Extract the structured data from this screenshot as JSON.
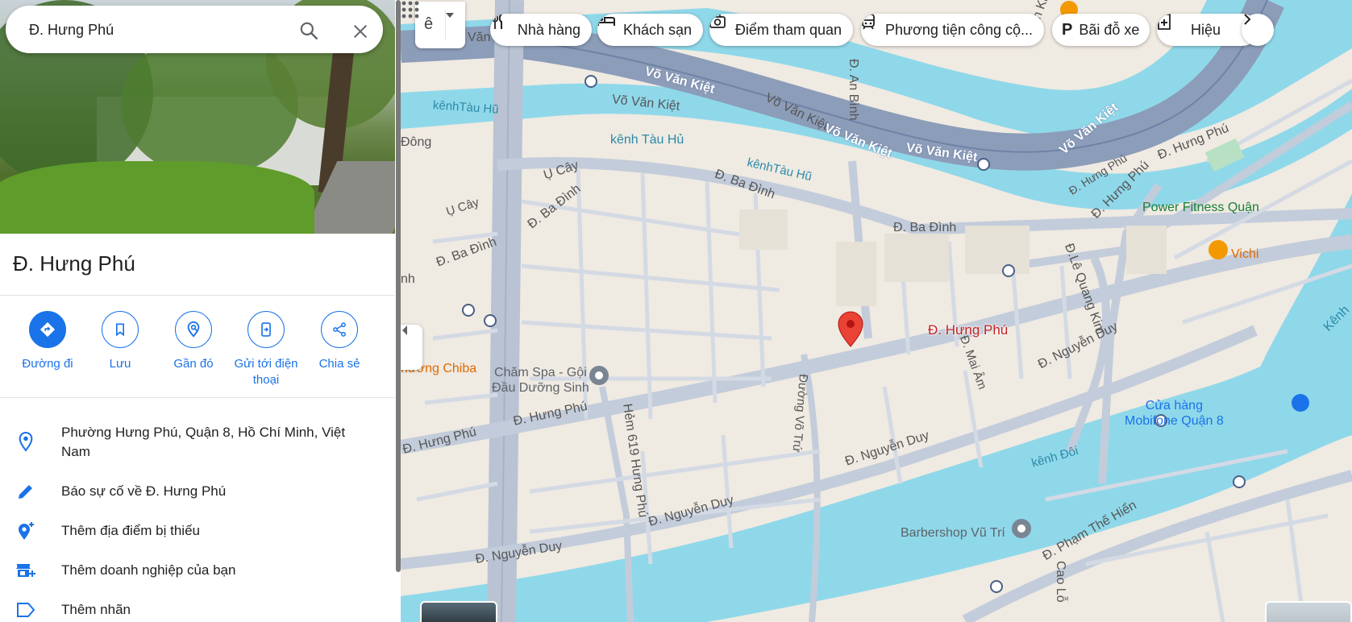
{
  "search": {
    "query": "Đ. Hưng Phú"
  },
  "place": {
    "title": "Đ. Hưng Phú"
  },
  "actions": [
    {
      "label": "Đường đi",
      "icon": "directions-icon"
    },
    {
      "label": "Lưu",
      "icon": "bookmark-icon"
    },
    {
      "label": "Gần đó",
      "icon": "nearby-icon"
    },
    {
      "label": "Gửi tới điện thoại",
      "icon": "send-to-phone-icon"
    },
    {
      "label": "Chia sẻ",
      "icon": "share-icon"
    }
  ],
  "details": [
    {
      "text": "Phường Hưng Phú, Quận 8, Hồ Chí Minh, Việt Nam",
      "icon": "location-pin-icon"
    },
    {
      "text": "Báo sự cố về Đ. Hưng Phú",
      "icon": "pencil-icon"
    },
    {
      "text": "Thêm địa điểm bị thiếu",
      "icon": "add-place-icon"
    },
    {
      "text": "Thêm doanh nghiệp của bạn",
      "icon": "add-business-icon"
    },
    {
      "text": "Thêm nhãn",
      "icon": "label-icon"
    }
  ],
  "layers": {
    "glyph": "ê"
  },
  "chips": [
    {
      "label": "Nhà hàng",
      "icon": "restaurant-icon"
    },
    {
      "label": "Khách sạn",
      "icon": "hotel-icon"
    },
    {
      "label": "Điểm tham quan",
      "icon": "camera-icon"
    },
    {
      "label": "Phương tiện công cộ...",
      "icon": "transit-icon"
    },
    {
      "label": "Bãi đỗ xe",
      "icon": "parking-icon"
    },
    {
      "label": "Hiệu",
      "icon": "pharmacy-icon"
    }
  ],
  "map": {
    "pin_label": "Đ. Hưng Phú",
    "labels": {
      "van_kiet_1": "Võ Văn Kiệt",
      "van_kiet_2": "Võ Văn Kiệt",
      "van_kiet_3": "Võ Văn Kiệt",
      "van_kiet_4": "Võ Văn Kiệt",
      "van_kiet_5": "Võ Văn Kiệt",
      "van_kiet_6": "Võ Văn Kiệt",
      "van_top": "Văn",
      "kenh_tau_hu_1": "kênhTàu Hũ",
      "kenh_tau_hu_2": "kênh Tàu Hủ",
      "kenh_tau_hu_3": "kênhTàu Hũ",
      "kenh_doi": "kênh Đôi",
      "kenh_right": "Kênh",
      "dong": "Đông",
      "u_cay_1": "Ụ Cây",
      "u_cay_2": "Ụ Cây",
      "ba_dinh_1": "Đ. Ba Đình",
      "ba_dinh_2": "Đ. Ba Đình",
      "ba_dinh_3": "Đ. Ba Đình",
      "ba_dinh_4": "Đ. Ba Đình",
      "nh": "nh",
      "an_binh": "Đ. An Bình",
      "tuan_khai": "Tuấn Khải",
      "hung_phu_1": "Đ. Hưng Phú",
      "hung_phu_2": "Đ. Hưng Phú",
      "hung_phu_3": "Đ. Hưng Phú",
      "hung_phu_4": "Đ. Hưng Phú",
      "hung_phu_5": "Đ. Hưng Phú",
      "le_quang_kim": "Đ.Lê Quang Kim",
      "mai_am": "Đ. Mai Âm",
      "vo_tru": "Đường Võ Trứ",
      "hem_619": "Hẻm 619 Hưng Phú",
      "nguyen_duy_1": "Đ. Nguyễn Duy",
      "nguyen_duy_2": "Đ. Nguyễn Duy",
      "nguyen_duy_3": "Đ. Nguyễn Duy",
      "nguyen_duy_4": "Đ. Nguyễn Duy",
      "pham_the_hien": "Đ. Phạm Thế Hiển",
      "cao_lo": "Cao Lỗ",
      "chiba": "hương Chiba",
      "cham_spa": "Chăm Spa - Gội\nĐầu Dưỡng Sinh",
      "power_fitness": "Power Fitness Quận",
      "vichi": "Vichi",
      "mobifone": "Cửa hàng\nMobifone Quận 8",
      "barbershop": "Barbershop Vũ Trí"
    }
  },
  "colors": {
    "water": "#8fd8ea",
    "highway": "#8c9db9",
    "road": "#b9c3d3",
    "land": "#efeae2",
    "accent": "#1a73e8",
    "pin": "#ea4335"
  }
}
